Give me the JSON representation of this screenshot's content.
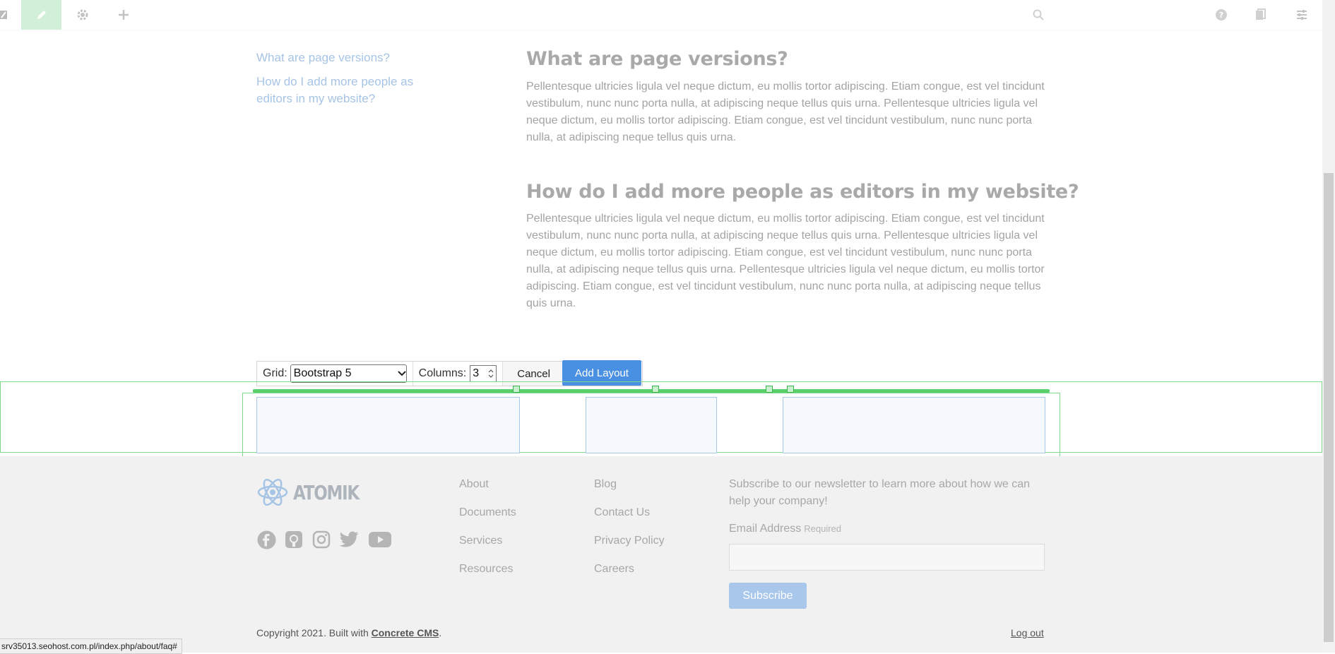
{
  "toolbar": {
    "search_placeholder": ""
  },
  "faq_nav": {
    "items": [
      "What are page versions?",
      "How do I add more people as editors in my website?"
    ]
  },
  "content": {
    "q1": "What are page versions?",
    "a1": "Pellentesque ultricies ligula vel neque dictum, eu mollis tortor adipiscing. Etiam congue, est vel tincidunt vestibulum, nunc nunc porta nulla, at adipiscing neque tellus quis urna. Pellentesque ultricies ligula vel neque dictum, eu mollis tortor adipiscing. Etiam congue, est vel tincidunt vestibulum, nunc nunc porta nulla, at adipiscing neque tellus quis urna.",
    "q2": "How do I add more people as editors in my website?",
    "a2": "Pellentesque ultricies ligula vel neque dictum, eu mollis tortor adipiscing. Etiam congue, est vel tincidunt vestibulum, nunc nunc porta nulla, at adipiscing neque tellus quis urna. Pellentesque ultricies ligula vel neque dictum, eu mollis tortor adipiscing. Etiam congue, est vel tincidunt vestibulum, nunc nunc porta nulla, at adipiscing neque tellus quis urna. Pellentesque ultricies ligula vel neque dictum, eu mollis tortor adipiscing. Etiam congue, est vel tincidunt vestibulum, nunc nunc porta nulla, at adipiscing neque tellus quis urna."
  },
  "layout_editor": {
    "grid_label": "Grid:",
    "grid_value": "Bootstrap 5",
    "columns_label": "Columns:",
    "columns_value": "3",
    "cancel_label": "Cancel",
    "add_label": "Add Layout"
  },
  "footer": {
    "logo_text": "ATOMIK",
    "col1": [
      "About",
      "Documents",
      "Services",
      "Resources"
    ],
    "col2": [
      "Blog",
      "Contact Us",
      "Privacy Policy",
      "Careers"
    ],
    "newsletter_text": "Subscribe to our newsletter to learn more about how we can help your company!",
    "email_label": "Email Address",
    "email_required": "Required",
    "subscribe_label": "Subscribe",
    "copyright_prefix": "Copyright 2021. Built with ",
    "copyright_link": "Concrete CMS",
    "copyright_suffix": ".",
    "logout_label": "Log out"
  },
  "statusbar": {
    "url": "srv35013.seohost.com.pl/index.php/about/faq#"
  },
  "colors": {
    "accent": "#4a90e2",
    "green": "#5ad06c",
    "edit_active": "#d1efd9"
  }
}
